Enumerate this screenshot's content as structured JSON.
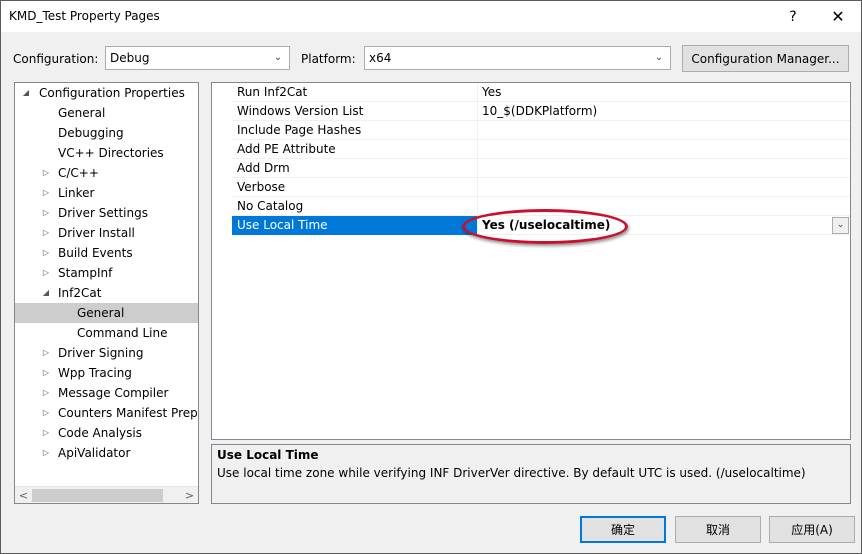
{
  "window": {
    "title": "KMD_Test Property Pages",
    "help_glyph": "?",
    "close_glyph": "✕"
  },
  "toolbar": {
    "configuration_label": "Configuration:",
    "configuration_value": "Debug",
    "platform_label": "Platform:",
    "platform_value": "x64",
    "config_manager_label": "Configuration Manager..."
  },
  "tree": {
    "items": [
      {
        "label": "Configuration Properties",
        "expander": "◢"
      },
      {
        "label": "General",
        "expander": ""
      },
      {
        "label": "Debugging",
        "expander": ""
      },
      {
        "label": "VC++ Directories",
        "expander": ""
      },
      {
        "label": "C/C++",
        "expander": "▷"
      },
      {
        "label": "Linker",
        "expander": "▷"
      },
      {
        "label": "Driver Settings",
        "expander": "▷"
      },
      {
        "label": "Driver Install",
        "expander": "▷"
      },
      {
        "label": "Build Events",
        "expander": "▷"
      },
      {
        "label": "StampInf",
        "expander": "▷"
      },
      {
        "label": "Inf2Cat",
        "expander": "◢"
      },
      {
        "label": "General",
        "expander": ""
      },
      {
        "label": "Command Line",
        "expander": ""
      },
      {
        "label": "Driver Signing",
        "expander": "▷"
      },
      {
        "label": "Wpp Tracing",
        "expander": "▷"
      },
      {
        "label": "Message Compiler",
        "expander": "▷"
      },
      {
        "label": "Counters Manifest Prepr",
        "expander": "▷"
      },
      {
        "label": "Code Analysis",
        "expander": "▷"
      },
      {
        "label": "ApiValidator",
        "expander": "▷"
      }
    ],
    "scroll_left": "<",
    "scroll_right": ">"
  },
  "grid": {
    "rows": [
      {
        "name": "Run Inf2Cat",
        "value": "Yes"
      },
      {
        "name": "Windows Version List",
        "value": "10_$(DDKPlatform)"
      },
      {
        "name": "Include Page Hashes",
        "value": ""
      },
      {
        "name": "Add PE Attribute",
        "value": ""
      },
      {
        "name": "Add Drm",
        "value": ""
      },
      {
        "name": "Verbose",
        "value": ""
      },
      {
        "name": "No Catalog",
        "value": ""
      },
      {
        "name": "Use Local Time",
        "value": "Yes (/uselocaltime)"
      }
    ],
    "dropdown_glyph": "⌄"
  },
  "description": {
    "title": "Use Local Time",
    "text": "Use local time zone while verifying INF DriverVer directive. By default UTC is used.  (/uselocaltime)"
  },
  "buttons": {
    "ok": "确定",
    "cancel": "取消",
    "apply": "应用(A)"
  },
  "colors": {
    "selection": "#0078d7",
    "highlight_ellipse": "#c8102e"
  }
}
